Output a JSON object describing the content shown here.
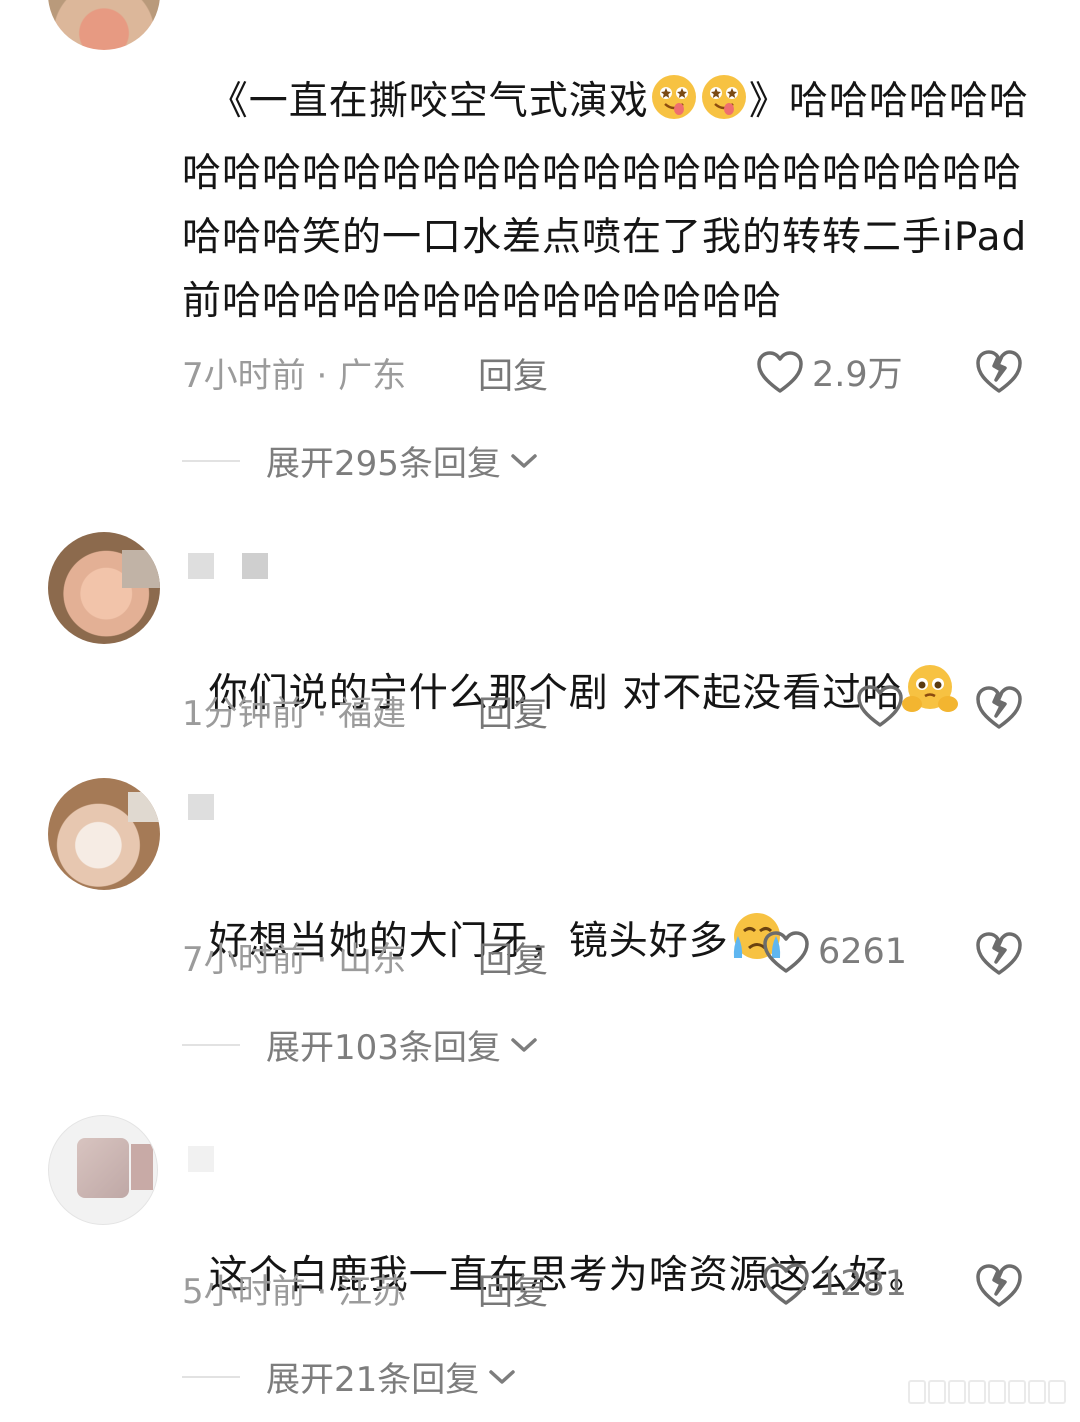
{
  "comments": [
    {
      "text": "《一直在撕咬空气式演戏",
      "text_after_emoji": "》哈哈哈哈哈哈哈哈哈哈哈哈哈哈哈哈哈哈哈哈哈哈哈哈哈哈哈哈哈哈笑的一口水差点喷在了我的转转二手iPad前哈哈哈哈哈哈哈哈哈哈哈哈哈哈",
      "time": "7小时前",
      "location": "广东",
      "reply_label": "回复",
      "likes": "2.9万",
      "expand_label": "展开295条回复"
    },
    {
      "text": "你们说的宁什么那个剧 对不起没看过哈",
      "time": "1分钟前",
      "location": "福建",
      "reply_label": "回复",
      "likes": ""
    },
    {
      "text": "好想当她的大门牙，镜头好多",
      "time": "7小时前",
      "location": "山东",
      "reply_label": "回复",
      "likes": "6261",
      "expand_label": "展开103条回复"
    },
    {
      "text": "这个白鹿我一直在思考为啥资源这么好。",
      "time": "5小时前",
      "location": "江苏",
      "reply_label": "回复",
      "likes": "1281",
      "expand_label": "展开21条回复"
    }
  ],
  "icons": {
    "like": "heart-outline-icon",
    "dislike": "broken-heart-icon",
    "expand": "chevron-down-icon",
    "emoji_1": "starry-eyed-drool-emoji",
    "emoji_2": "pleading-face-emoji",
    "emoji_3": "crying-face-emoji"
  },
  "colors": {
    "text": "#151515",
    "meta": "#9b9b9b",
    "secondary": "#7c7c7c",
    "divider": "#e2e2e2"
  }
}
